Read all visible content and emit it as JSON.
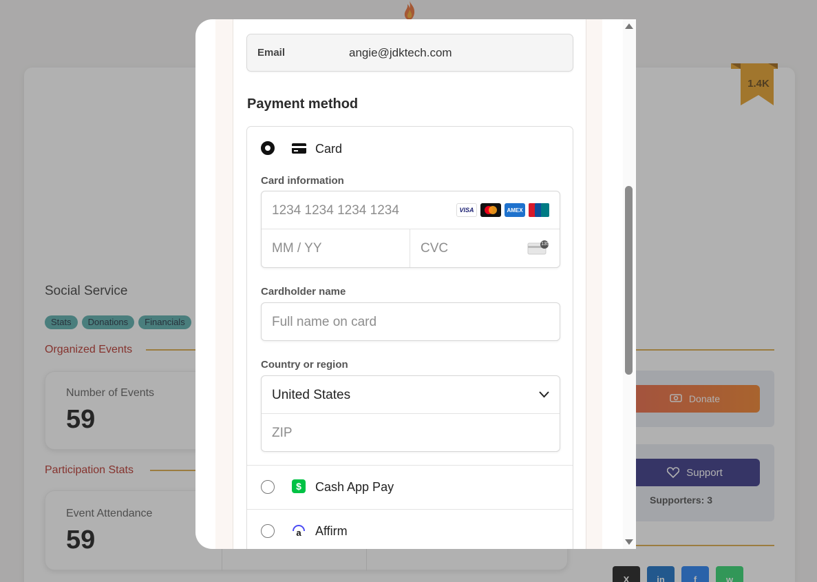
{
  "background": {
    "badge": "1.4K",
    "org_title": "Social Service",
    "tags": [
      "Stats",
      "Donations",
      "Financials"
    ],
    "sections": {
      "organized_events": "Organized Events",
      "participation_stats": "Participation Stats"
    },
    "stats": {
      "events_label": "Number of Events",
      "events_value": "59",
      "attendance_label": "Event Attendance",
      "attendance_value": "59"
    },
    "donate_label": "Donate",
    "support_label": "Support",
    "supporters_text": "Supporters: 3"
  },
  "checkout": {
    "email_label": "Email",
    "email_value": "angie@jdktech.com",
    "payment_method_title": "Payment method",
    "card_option_label": "Card",
    "card_information_label": "Card information",
    "card_number_placeholder": "1234 1234 1234 1234",
    "expiry_placeholder": "MM / YY",
    "cvc_placeholder": "CVC",
    "cvc_badge": "135",
    "card_brands": [
      "VISA",
      "Mastercard",
      "AMEX",
      "UnionPay"
    ],
    "cardholder_label": "Cardholder name",
    "cardholder_placeholder": "Full name on card",
    "country_label": "Country or region",
    "country_value": "United States",
    "zip_placeholder": "ZIP",
    "other_methods": [
      "Cash App Pay",
      "Affirm"
    ]
  },
  "colors": {
    "accent_red": "#b3261e",
    "teal_tag": "#4fa8a6",
    "gold_line": "#d9a43b",
    "donate_orange": "#f07a1e",
    "support_navy": "#2b2a7e",
    "cashapp_green": "#00c244"
  },
  "icons": [
    "flame-icon",
    "ribbon-badge-icon",
    "card-icon",
    "chevron-down-icon",
    "cash-app-icon",
    "affirm-icon",
    "heart-icon",
    "donate-icon"
  ]
}
